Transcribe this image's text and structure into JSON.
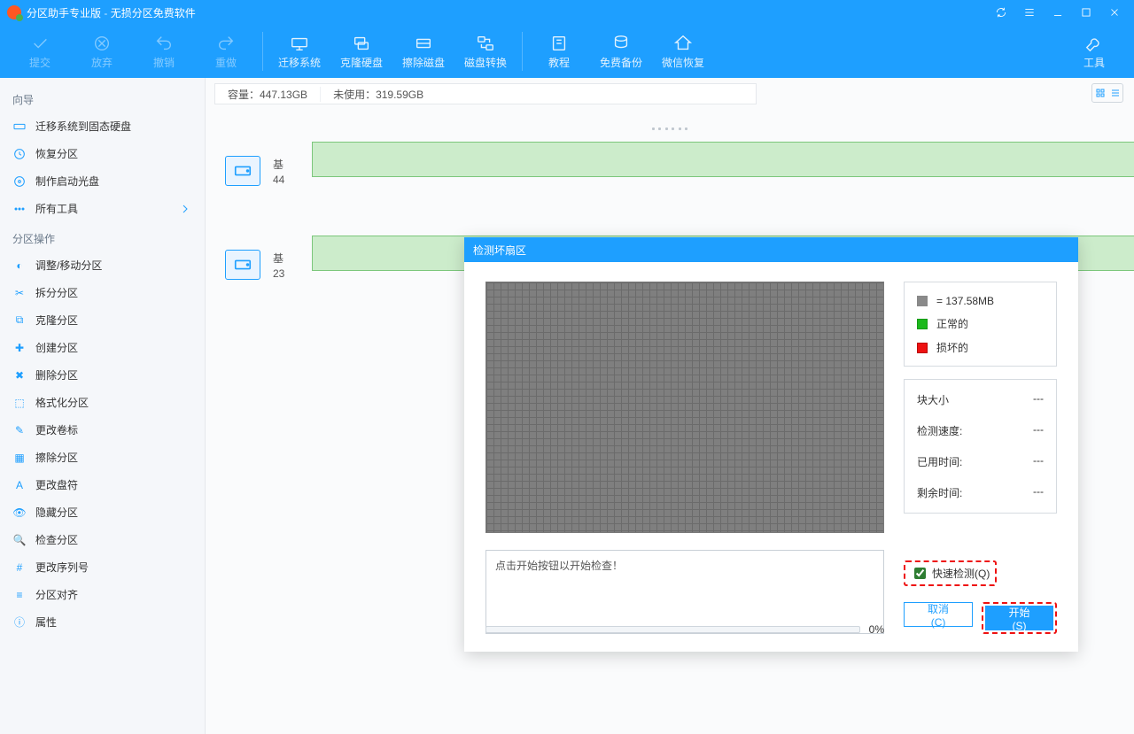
{
  "window": {
    "app_name": "分区助手专业版",
    "subtitle": "无损分区免费软件"
  },
  "toolbar": {
    "commit": "提交",
    "discard": "放弃",
    "undo": "撤销",
    "redo": "重做",
    "migrate_system": "迁移系统",
    "clone_disk": "克隆硬盘",
    "wipe_disk": "擦除磁盘",
    "disk_convert": "磁盘转换",
    "tutorial": "教程",
    "free_backup": "免费备份",
    "wechat_recover": "微信恢复",
    "tools": "工具"
  },
  "sidebar": {
    "section_wizard": "向导",
    "wizard": {
      "migrate_ssd": "迁移系统到固态硬盘",
      "recover_partition": "恢复分区",
      "make_boot_cd": "制作启动光盘",
      "all_tools": "所有工具"
    },
    "section_ops": "分区操作",
    "ops": [
      "调整/移动分区",
      "拆分分区",
      "克隆分区",
      "创建分区",
      "删除分区",
      "格式化分区",
      "更改卷标",
      "擦除分区",
      "更改盘符",
      "隐藏分区",
      "检查分区",
      "更改序列号",
      "分区对齐",
      "属性"
    ]
  },
  "disk_info": {
    "capacity_label": "容量：",
    "capacity_value": "447.13GB",
    "unused_label": "未使用：",
    "unused_value": "319.59GB",
    "row1_letter": "基",
    "row1_size": "44",
    "row2_letter": "基",
    "row2_size": "23"
  },
  "dialog": {
    "title": "检测坏扇区",
    "legend": {
      "block_size_value": "= 137.58MB",
      "normal": "正常的",
      "damaged": "损坏的"
    },
    "stats": {
      "block_size_label": "块大小",
      "block_size_value": "---",
      "speed_label": "检测速度:",
      "speed_value": "---",
      "elapsed_label": "已用时间:",
      "elapsed_value": "---",
      "remaining_label": "剩余时间:",
      "remaining_value": "---"
    },
    "log_hint": "点击开始按钮以开始检查！",
    "quick_check": "快速检测(Q)",
    "cancel": "取消(C)",
    "start": "开始(S)",
    "progress": "0%"
  }
}
